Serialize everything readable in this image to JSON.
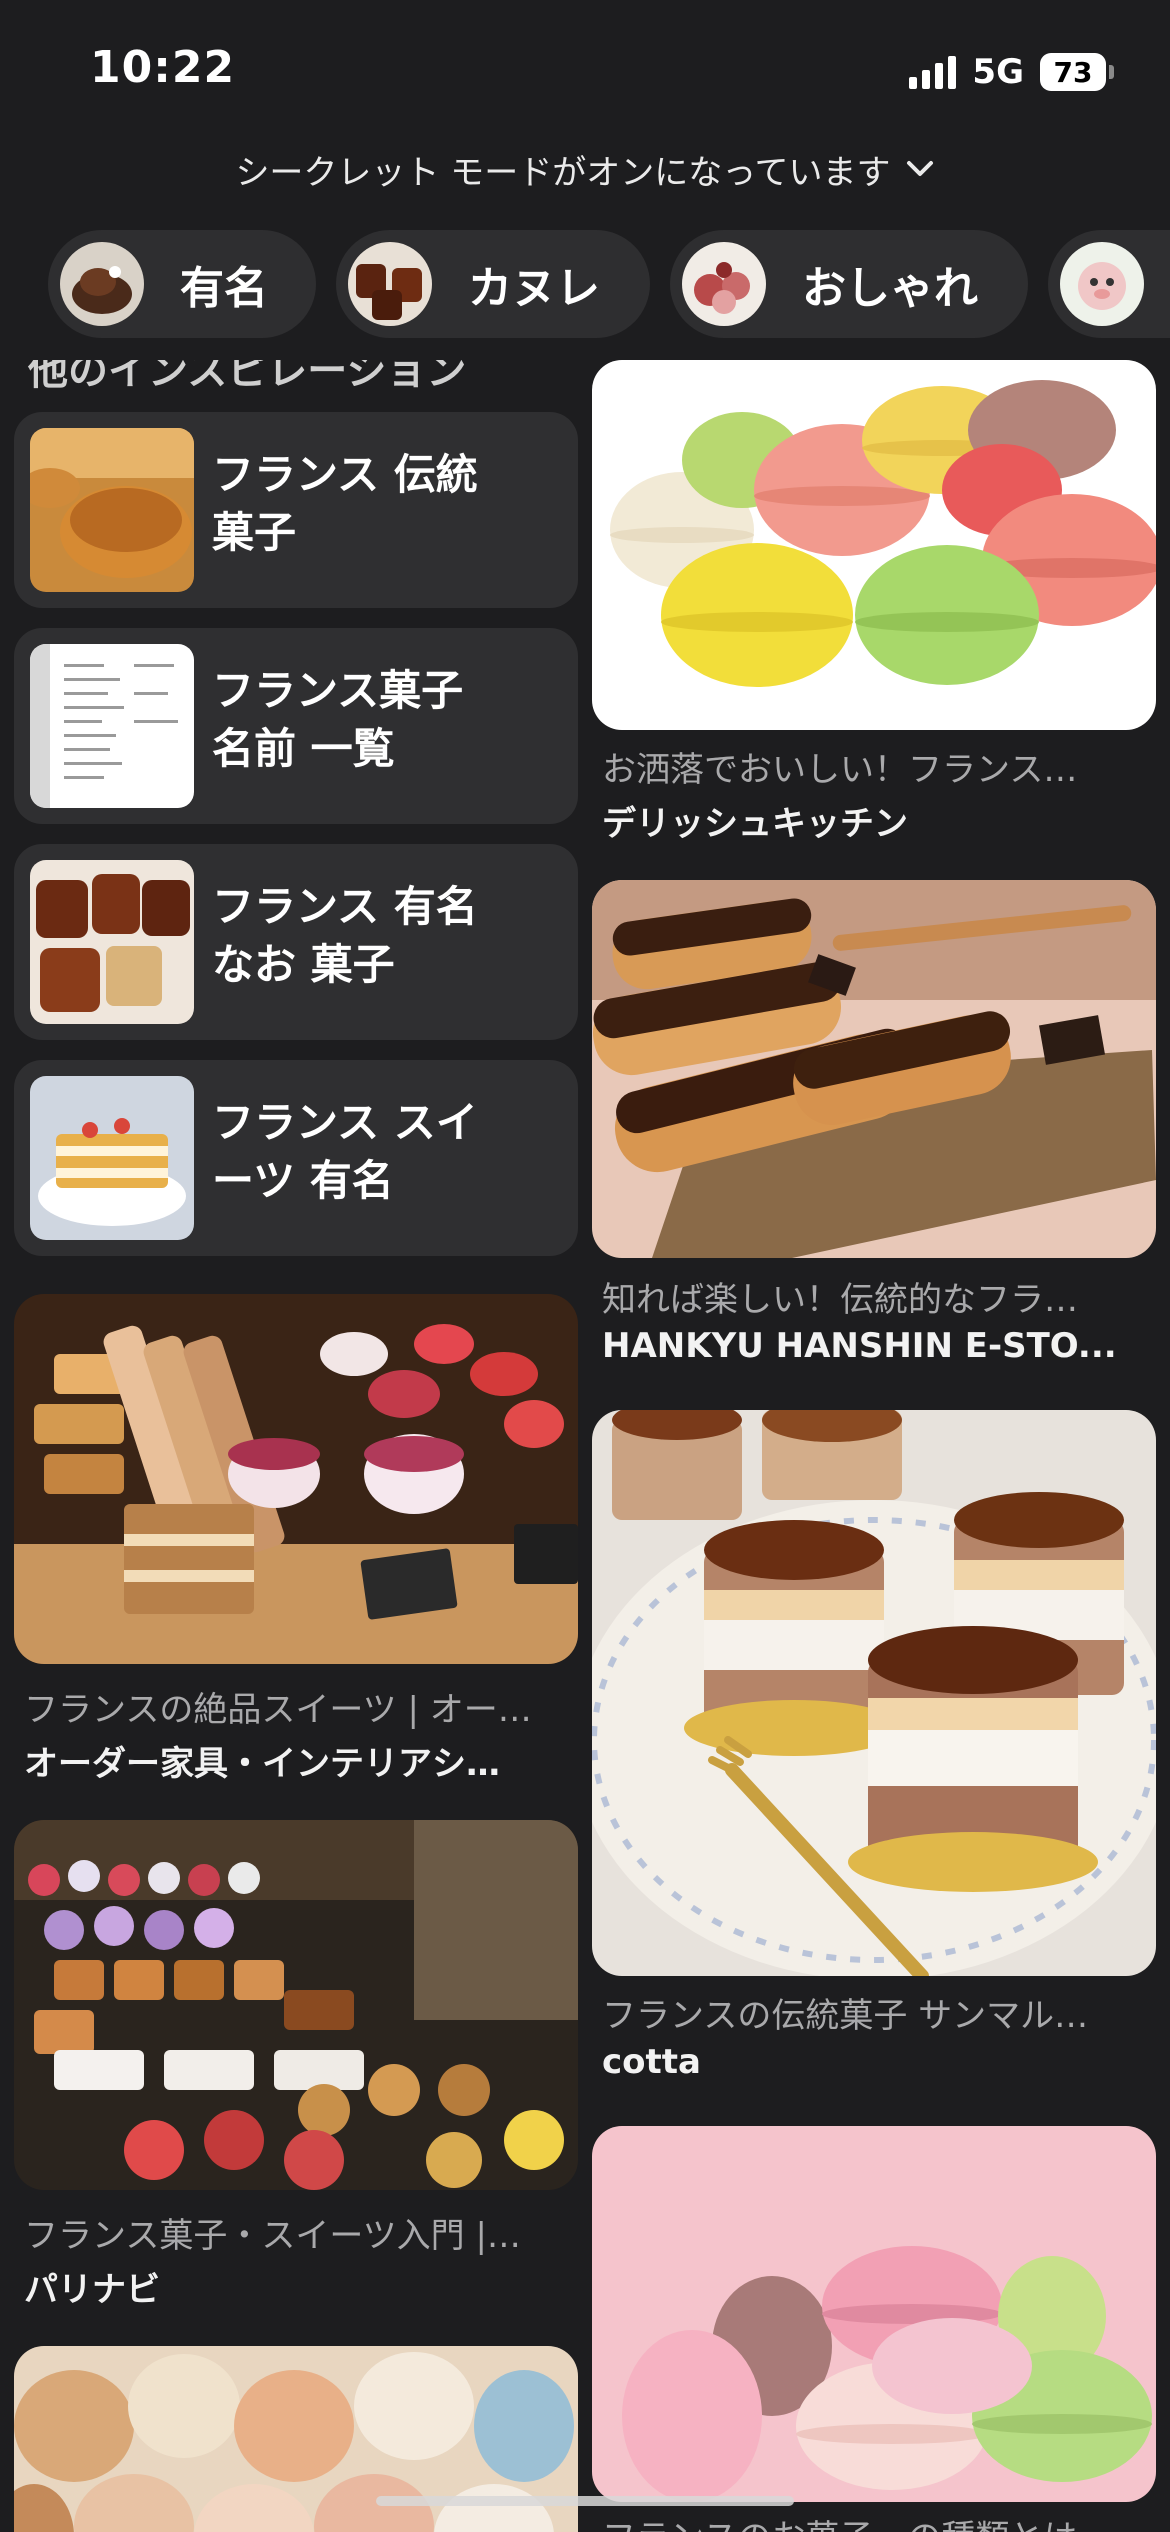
{
  "status_bar": {
    "time": "10:22",
    "network": "5G",
    "battery": "73",
    "icons": [
      "signal-bars-icon",
      "battery-icon"
    ]
  },
  "banner": {
    "text": "シークレット モードがオンになっています",
    "icon": "chevron-down-icon"
  },
  "chips": [
    {
      "label": "有名"
    },
    {
      "label": "カヌレ"
    },
    {
      "label": "おしゃれ"
    },
    {
      "label": ""
    }
  ],
  "feed": {
    "partial_heading": "他のインスピレーション",
    "suggestions": [
      {
        "line1": "フランス 伝統",
        "line2": "菓子"
      },
      {
        "line1": "フランス菓子",
        "line2": "名前 一覧"
      },
      {
        "line1": "フランス 有名",
        "line2": "なお 菓子"
      },
      {
        "line1": "フランス スイ",
        "line2": "ーツ 有名"
      }
    ],
    "pins_left": [
      {
        "title": "フランスの絶品スイーツ | オー…",
        "source": "オーダー家具・インテリアシ…"
      },
      {
        "title": "フランス菓子・スイーツ入門 |…",
        "source": "パリナビ"
      }
    ],
    "pins_right": [
      {
        "title": "お洒落でおいしい！フランス…",
        "source": "デリッシュキッチン"
      },
      {
        "title": "知れば楽しい！伝統的なフラ…",
        "source": "HANKYU HANSHIN E-STO..."
      },
      {
        "title": "フランスの伝統菓子 サンマル…",
        "source": "cotta"
      },
      {
        "title": "フランスのお菓子、の種類とは…",
        "source": ""
      }
    ]
  },
  "colors": {
    "background": "#1d1d1f",
    "card": "#2f2f31",
    "chip": "#2e2e30",
    "title_gray": "#a9a9ab"
  }
}
